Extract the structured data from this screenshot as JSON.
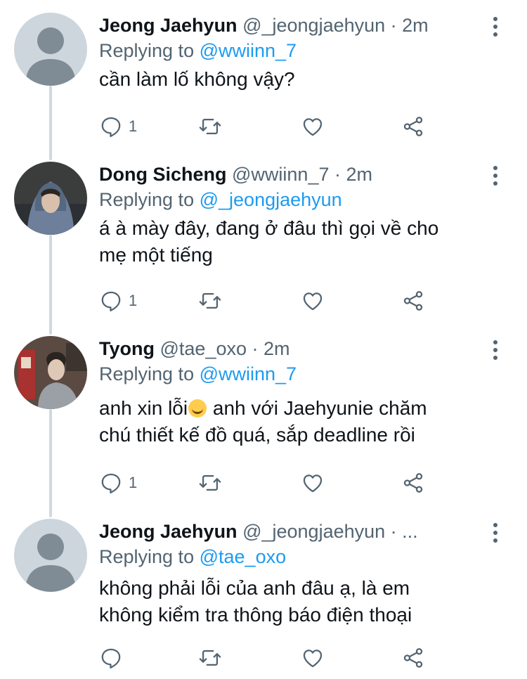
{
  "tweets": [
    {
      "name": "Jeong Jaehyun",
      "handle": "@_jeongjaehyun",
      "time": "· 2m",
      "replying_prefix": "Replying to",
      "replying_to": "@wwiinn_7",
      "text": "cần làm lố không vậy?",
      "text_lines": [
        "cần làm lố không vậy?"
      ],
      "reply_count": "1",
      "avatar": "default-avatar"
    },
    {
      "name": "Dong Sicheng",
      "handle": "@wwiinn_7",
      "time": "· 2m",
      "replying_prefix": "Replying to",
      "replying_to": "@_jeongjaehyun",
      "text_lines": [
        "á à mày đây, đang ở đâu thì gọi về cho",
        "mẹ một tiếng"
      ],
      "reply_count": "1",
      "avatar": "hooded-person-photo"
    },
    {
      "name": "Tyong",
      "handle": "@tae_oxo",
      "time": "· 2m",
      "replying_prefix": "Replying to",
      "replying_to": "@wwiinn_7",
      "text_line1_a": "anh xin lỗi",
      "text_line1_b": " anh với Jaehyunie chăm",
      "text_line2": "chú thiết kế đồ quá, sắp deadline rồi",
      "emoji": "grinning-sweat-emoji",
      "reply_count": "1",
      "avatar": "person-photo"
    },
    {
      "name": "Jeong Jaehyun",
      "handle": "@_jeongjaehyun",
      "time": "· ...",
      "replying_prefix": "Replying to",
      "replying_to": "@tae_oxo",
      "text_lines": [
        "không phải lỗi của anh đâu ạ, là em",
        "không kiểm tra thông báo điện thoại"
      ],
      "reply_count": "",
      "avatar": "default-avatar"
    }
  ],
  "icons": [
    "reply-icon",
    "retweet-icon",
    "like-icon",
    "share-icon",
    "more-icon"
  ],
  "colors": {
    "link": "#1d9bf0",
    "muted": "#536471",
    "text": "#0f1419",
    "thread": "#cfd9de"
  }
}
